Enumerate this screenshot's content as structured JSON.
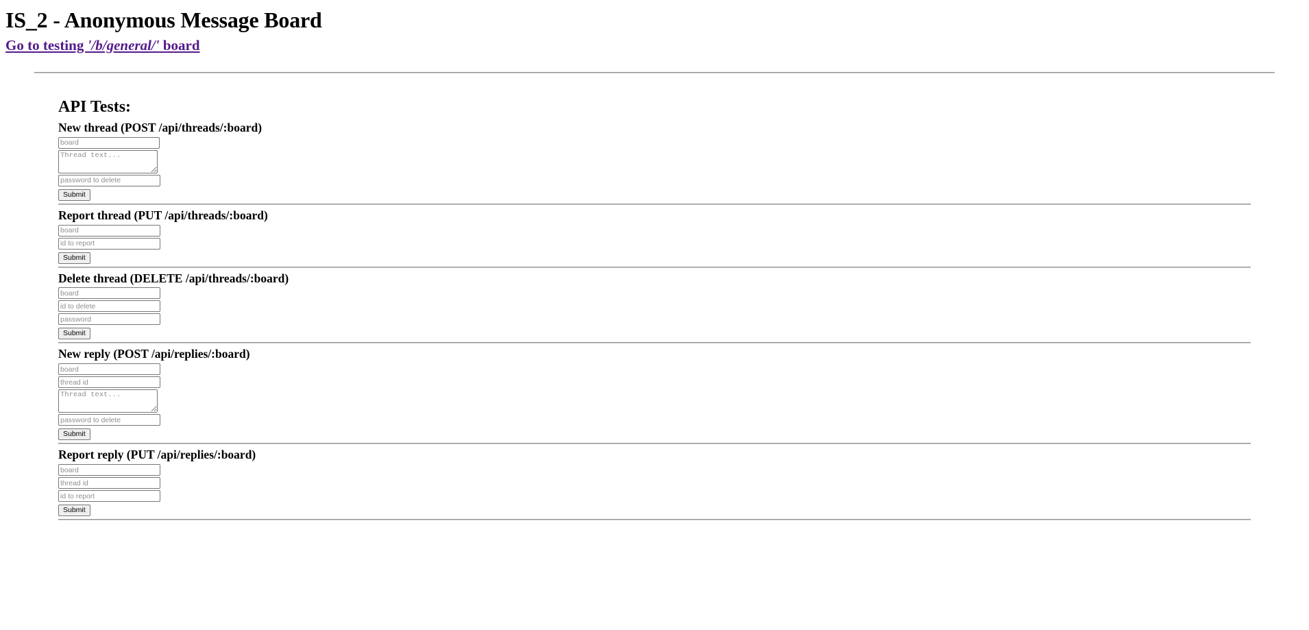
{
  "header": {
    "title": "IS_2 - Anonymous Message Board",
    "link_prefix": "Go to testing ",
    "link_board": "'/b/general/'",
    "link_suffix": " board",
    "link_color": "#551a8b"
  },
  "main": {
    "section_title": "API Tests:",
    "submit_label": "Submit",
    "forms": [
      {
        "heading": "New thread (POST /api/threads/:board)",
        "fields": [
          {
            "kind": "input",
            "placeholder": "board",
            "value": ""
          },
          {
            "kind": "textarea",
            "placeholder": "Thread text...",
            "value": ""
          },
          {
            "kind": "input",
            "placeholder": "password to delete",
            "value": ""
          }
        ],
        "submit": "Submit"
      },
      {
        "heading": "Report thread (PUT /api/threads/:board)",
        "fields": [
          {
            "kind": "input",
            "placeholder": "board",
            "value": ""
          },
          {
            "kind": "input",
            "placeholder": "id to report",
            "value": ""
          }
        ],
        "submit": "Submit"
      },
      {
        "heading": "Delete thread (DELETE /api/threads/:board)",
        "fields": [
          {
            "kind": "input",
            "placeholder": "board",
            "value": ""
          },
          {
            "kind": "input",
            "placeholder": "id to delete",
            "value": ""
          },
          {
            "kind": "input",
            "placeholder": "password",
            "value": ""
          }
        ],
        "submit": "Submit"
      },
      {
        "heading": "New reply (POST /api/replies/:board)",
        "fields": [
          {
            "kind": "input",
            "placeholder": "board",
            "value": ""
          },
          {
            "kind": "input",
            "placeholder": "thread id",
            "value": ""
          },
          {
            "kind": "textarea",
            "placeholder": "Thread text...",
            "value": ""
          },
          {
            "kind": "input",
            "placeholder": "password to delete",
            "value": ""
          }
        ],
        "submit": "Submit"
      },
      {
        "heading": "Report reply (PUT /api/replies/:board)",
        "fields": [
          {
            "kind": "input",
            "placeholder": "board",
            "value": ""
          },
          {
            "kind": "input",
            "placeholder": "thread id",
            "value": ""
          },
          {
            "kind": "input",
            "placeholder": "id to report",
            "value": ""
          }
        ],
        "submit": "Submit"
      }
    ]
  }
}
